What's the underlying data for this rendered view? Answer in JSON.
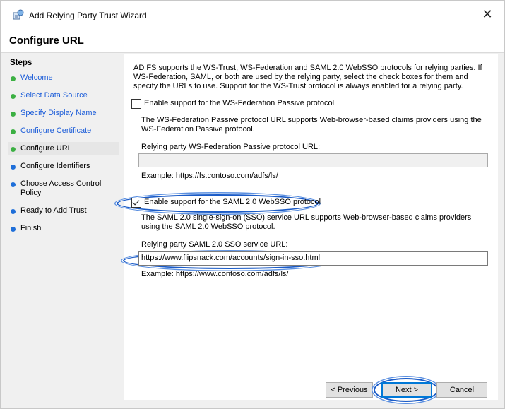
{
  "window": {
    "title": "Add Relying Party Trust Wizard",
    "close_glyph": "✕",
    "icon": "wizard-app-icon"
  },
  "header": {
    "page_title": "Configure URL"
  },
  "steps": {
    "title": "Steps",
    "items": [
      {
        "label": "Welcome",
        "state": "done"
      },
      {
        "label": "Select Data Source",
        "state": "done"
      },
      {
        "label": "Specify Display Name",
        "state": "done"
      },
      {
        "label": "Configure Certificate",
        "state": "done"
      },
      {
        "label": "Configure URL",
        "state": "current"
      },
      {
        "label": "Configure Identifiers",
        "state": "todo"
      },
      {
        "label": "Choose Access Control Policy",
        "state": "todo"
      },
      {
        "label": "Ready to Add Trust",
        "state": "todo"
      },
      {
        "label": "Finish",
        "state": "todo"
      }
    ]
  },
  "main": {
    "intro": "AD FS supports the WS-Trust, WS-Federation and SAML 2.0 WebSSO protocols for relying parties.  If WS-Federation, SAML, or both are used by the relying party, select the check boxes for them and specify the URLs to use.  Support for the WS-Trust protocol is always enabled for a relying party.",
    "wsfed": {
      "checkbox_label": "Enable support for the WS-Federation Passive protocol",
      "checked": false,
      "description": "The WS-Federation Passive protocol URL supports Web-browser-based claims providers using the WS-Federation Passive protocol.",
      "url_label": "Relying party WS-Federation Passive protocol URL:",
      "url_value": "",
      "example": "Example: https://fs.contoso.com/adfs/ls/"
    },
    "saml": {
      "checkbox_label": "Enable support for the SAML 2.0 WebSSO protocol",
      "checked": true,
      "description": "The SAML 2.0 single-sign-on (SSO) service URL supports Web-browser-based claims providers using the SAML 2.0 WebSSO protocol.",
      "url_label": "Relying party SAML 2.0 SSO service URL:",
      "url_value": "https://www.flipsnack.com/accounts/sign-in-sso.html",
      "example": "Example: https://www.contoso.com/adfs/ls/"
    }
  },
  "footer": {
    "previous_label": "< Previous",
    "next_label": "Next >",
    "cancel_label": "Cancel"
  },
  "colors": {
    "done_dot": "#3cb043",
    "todo_dot": "#1f6fd9",
    "link": "#1f5fd9",
    "highlight": "#1a5bc7"
  }
}
